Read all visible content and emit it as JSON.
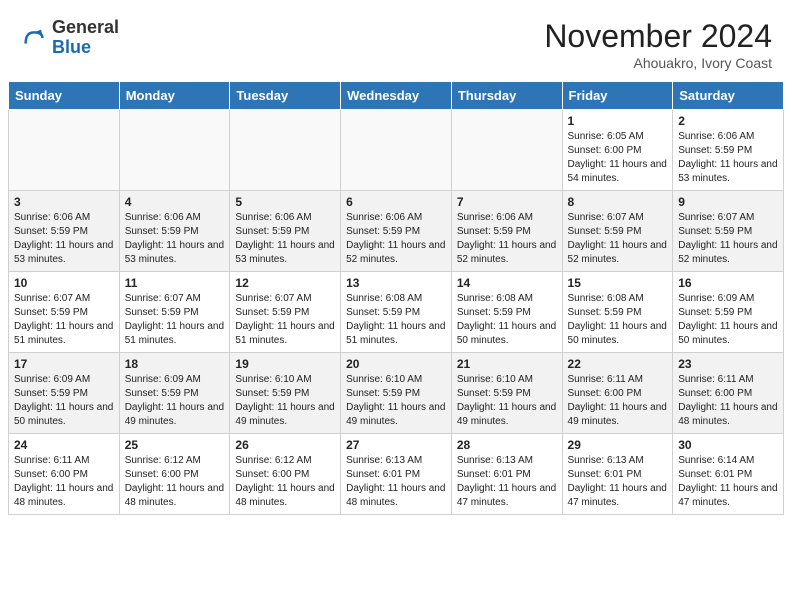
{
  "header": {
    "logo_general": "General",
    "logo_blue": "Blue",
    "month_year": "November 2024",
    "location": "Ahouakro, Ivory Coast"
  },
  "weekdays": [
    "Sunday",
    "Monday",
    "Tuesday",
    "Wednesday",
    "Thursday",
    "Friday",
    "Saturday"
  ],
  "weeks": [
    [
      {
        "day": "",
        "empty": true
      },
      {
        "day": "",
        "empty": true
      },
      {
        "day": "",
        "empty": true
      },
      {
        "day": "",
        "empty": true
      },
      {
        "day": "",
        "empty": true
      },
      {
        "day": "1",
        "sunrise": "6:05 AM",
        "sunset": "6:00 PM",
        "daylight": "11 hours and 54 minutes."
      },
      {
        "day": "2",
        "sunrise": "6:06 AM",
        "sunset": "5:59 PM",
        "daylight": "11 hours and 53 minutes."
      }
    ],
    [
      {
        "day": "3",
        "sunrise": "6:06 AM",
        "sunset": "5:59 PM",
        "daylight": "11 hours and 53 minutes."
      },
      {
        "day": "4",
        "sunrise": "6:06 AM",
        "sunset": "5:59 PM",
        "daylight": "11 hours and 53 minutes."
      },
      {
        "day": "5",
        "sunrise": "6:06 AM",
        "sunset": "5:59 PM",
        "daylight": "11 hours and 53 minutes."
      },
      {
        "day": "6",
        "sunrise": "6:06 AM",
        "sunset": "5:59 PM",
        "daylight": "11 hours and 52 minutes."
      },
      {
        "day": "7",
        "sunrise": "6:06 AM",
        "sunset": "5:59 PM",
        "daylight": "11 hours and 52 minutes."
      },
      {
        "day": "8",
        "sunrise": "6:07 AM",
        "sunset": "5:59 PM",
        "daylight": "11 hours and 52 minutes."
      },
      {
        "day": "9",
        "sunrise": "6:07 AM",
        "sunset": "5:59 PM",
        "daylight": "11 hours and 52 minutes."
      }
    ],
    [
      {
        "day": "10",
        "sunrise": "6:07 AM",
        "sunset": "5:59 PM",
        "daylight": "11 hours and 51 minutes."
      },
      {
        "day": "11",
        "sunrise": "6:07 AM",
        "sunset": "5:59 PM",
        "daylight": "11 hours and 51 minutes."
      },
      {
        "day": "12",
        "sunrise": "6:07 AM",
        "sunset": "5:59 PM",
        "daylight": "11 hours and 51 minutes."
      },
      {
        "day": "13",
        "sunrise": "6:08 AM",
        "sunset": "5:59 PM",
        "daylight": "11 hours and 51 minutes."
      },
      {
        "day": "14",
        "sunrise": "6:08 AM",
        "sunset": "5:59 PM",
        "daylight": "11 hours and 50 minutes."
      },
      {
        "day": "15",
        "sunrise": "6:08 AM",
        "sunset": "5:59 PM",
        "daylight": "11 hours and 50 minutes."
      },
      {
        "day": "16",
        "sunrise": "6:09 AM",
        "sunset": "5:59 PM",
        "daylight": "11 hours and 50 minutes."
      }
    ],
    [
      {
        "day": "17",
        "sunrise": "6:09 AM",
        "sunset": "5:59 PM",
        "daylight": "11 hours and 50 minutes."
      },
      {
        "day": "18",
        "sunrise": "6:09 AM",
        "sunset": "5:59 PM",
        "daylight": "11 hours and 49 minutes."
      },
      {
        "day": "19",
        "sunrise": "6:10 AM",
        "sunset": "5:59 PM",
        "daylight": "11 hours and 49 minutes."
      },
      {
        "day": "20",
        "sunrise": "6:10 AM",
        "sunset": "5:59 PM",
        "daylight": "11 hours and 49 minutes."
      },
      {
        "day": "21",
        "sunrise": "6:10 AM",
        "sunset": "5:59 PM",
        "daylight": "11 hours and 49 minutes."
      },
      {
        "day": "22",
        "sunrise": "6:11 AM",
        "sunset": "6:00 PM",
        "daylight": "11 hours and 49 minutes."
      },
      {
        "day": "23",
        "sunrise": "6:11 AM",
        "sunset": "6:00 PM",
        "daylight": "11 hours and 48 minutes."
      }
    ],
    [
      {
        "day": "24",
        "sunrise": "6:11 AM",
        "sunset": "6:00 PM",
        "daylight": "11 hours and 48 minutes."
      },
      {
        "day": "25",
        "sunrise": "6:12 AM",
        "sunset": "6:00 PM",
        "daylight": "11 hours and 48 minutes."
      },
      {
        "day": "26",
        "sunrise": "6:12 AM",
        "sunset": "6:00 PM",
        "daylight": "11 hours and 48 minutes."
      },
      {
        "day": "27",
        "sunrise": "6:13 AM",
        "sunset": "6:01 PM",
        "daylight": "11 hours and 48 minutes."
      },
      {
        "day": "28",
        "sunrise": "6:13 AM",
        "sunset": "6:01 PM",
        "daylight": "11 hours and 47 minutes."
      },
      {
        "day": "29",
        "sunrise": "6:13 AM",
        "sunset": "6:01 PM",
        "daylight": "11 hours and 47 minutes."
      },
      {
        "day": "30",
        "sunrise": "6:14 AM",
        "sunset": "6:01 PM",
        "daylight": "11 hours and 47 minutes."
      }
    ]
  ],
  "labels": {
    "sunrise": "Sunrise:",
    "sunset": "Sunset:",
    "daylight": "Daylight:"
  }
}
